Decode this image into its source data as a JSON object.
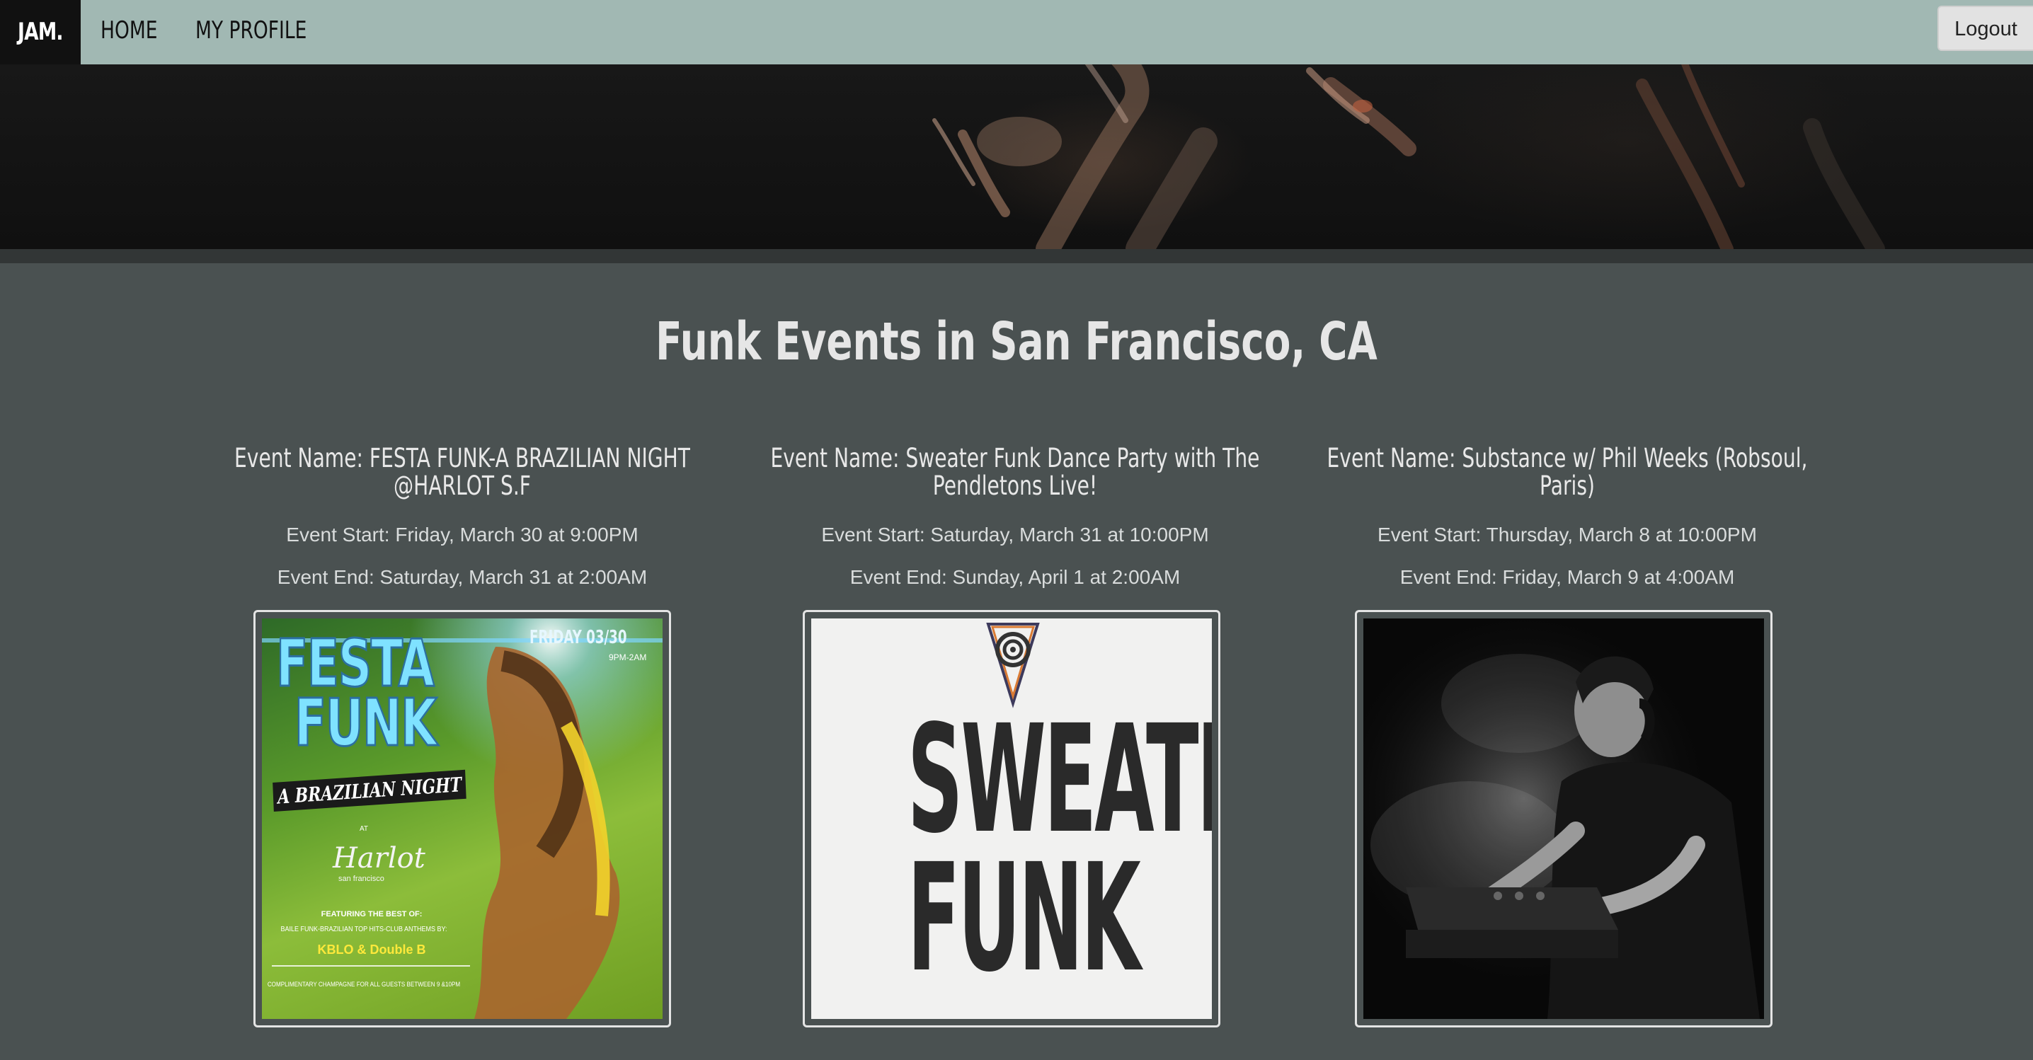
{
  "navbar": {
    "brand": "JAM.",
    "links": [
      "HOME",
      "MY PROFILE"
    ],
    "logout_label": "Logout"
  },
  "page_title": "Funk Events in San Francisco, CA",
  "events": [
    {
      "name": "Event Name: FESTA FUNK-A BRAZILIAN NIGHT @HARLOT S.F",
      "start": "Event Start: Friday, March 30 at 9:00PM",
      "end": "Event End: Saturday, March 31 at 2:00AM",
      "poster": {
        "title_line1": "FESTA",
        "title_line2": "FUNK",
        "subtitle": "A BRAZILIAN NIGHT",
        "date": "FRIDAY 03/30",
        "time": "9PM-2AM",
        "venue_at": "AT",
        "venue": "Harlot",
        "venue_city": "san francisco",
        "featuring": "FEATURING THE BEST OF:",
        "genre_line": "BAILE FUNK-BRAZILIAN TOP HITS-CLUB ANTHEMS BY:",
        "djs": "KBLO & Double B",
        "footer": "COMPLIMENTARY CHAMPAGNE FOR ALL GUESTS BETWEEN 9 &10PM"
      }
    },
    {
      "name": "Event Name: Sweater Funk Dance Party with The Pendletons Live!",
      "start": "Event Start: Saturday, March 31 at 10:00PM",
      "end": "Event End: Sunday, April 1 at 2:00AM",
      "poster": {
        "line1": "SWEATER",
        "line2": "FUNK"
      }
    },
    {
      "name": "Event Name: Substance w/ Phil Weeks (Robsoul, Paris)",
      "start": "Event Start: Thursday, March 8 at 10:00PM",
      "end": "Event End: Friday, March 9 at 4:00AM"
    }
  ]
}
